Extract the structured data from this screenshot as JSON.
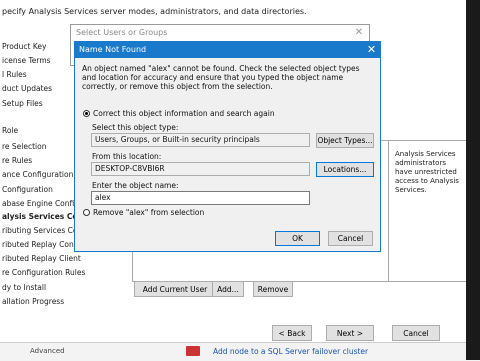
{
  "wizard": {
    "header_text": "pecify Analysis Services server modes, administrators, and data directories.",
    "nav_items": [
      {
        "label": "Product Key",
        "bold": false
      },
      {
        "label": "icense Terms",
        "bold": false
      },
      {
        "label": "l Rules",
        "bold": false
      },
      {
        "label": "duct Updates",
        "bold": false
      },
      {
        "label": "Setup Files",
        "bold": false
      },
      {
        "label": "Role",
        "bold": false
      },
      {
        "label": "re Selection",
        "bold": false
      },
      {
        "label": "re Rules",
        "bold": false
      },
      {
        "label": "ance Configuration",
        "bold": false
      },
      {
        "label": "Configuration",
        "bold": false
      },
      {
        "label": "abase Engine Configu",
        "bold": false
      },
      {
        "label": "alysis Services Confi",
        "bold": true
      },
      {
        "label": "ributing Services Confi",
        "bold": false
      },
      {
        "label": "ributed Replay Contro",
        "bold": false
      },
      {
        "label": "ributed Replay Client",
        "bold": false
      },
      {
        "label": "re Configuration Rules",
        "bold": false
      },
      {
        "label": "dy to Install",
        "bold": false
      },
      {
        "label": "allation Progress",
        "bold": false
      }
    ],
    "right_panel_text": "Analysis Services administrators have unrestricted access to Analysis Services.",
    "buttons": {
      "add_current_user": "Add Current User",
      "add": "Add...",
      "remove": "Remove",
      "back": "< Back",
      "next": "Next >",
      "cancel": "Cancel"
    },
    "bottom_left": "Advanced",
    "bottom_link": "Add node to a SQL Server failover cluster"
  },
  "select_dialog": {
    "title": "Select Users or Groups",
    "close_glyph": "✕"
  },
  "dialog": {
    "title": "Name Not Found",
    "close_glyph": "✕",
    "message": "An object named \"alex\" cannot be found. Check the selected object types and location for accuracy and ensure that you typed the object name correctly, or remove this object from the selection.",
    "option_correct": "Correct this object information and search again",
    "object_type_label": "Select this object type:",
    "object_type_value": "Users, Groups, or Built-in security principals",
    "object_types_button": "Object Types...",
    "location_label": "From this location:",
    "location_value": "DESKTOP-C8VBI6R",
    "locations_button": "Locations...",
    "object_name_label": "Enter the object name:",
    "object_name_value": "alex",
    "option_remove": "Remove \"alex\" from selection",
    "ok": "OK",
    "cancel": "Cancel",
    "selected_option": "correct"
  },
  "colors": {
    "accent": "#1979ca"
  }
}
